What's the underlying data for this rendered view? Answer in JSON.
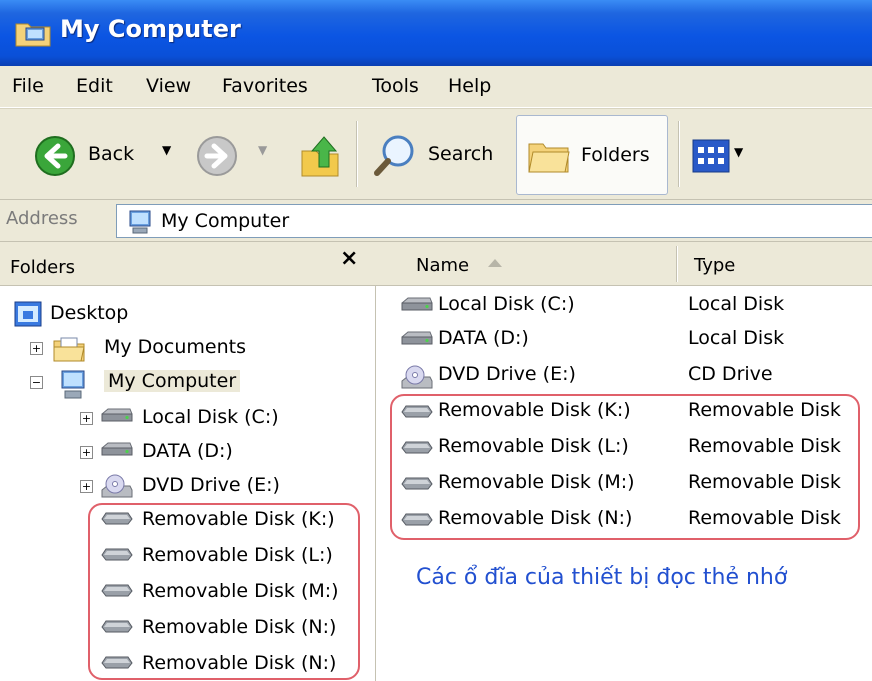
{
  "window": {
    "title": "My Computer",
    "title_icon": "folder-computer-icon"
  },
  "menu": [
    "File",
    "Edit",
    "View",
    "Favorites",
    "Tools",
    "Help"
  ],
  "toolbar": {
    "back_label": "Back",
    "search_label": "Search",
    "folders_label": "Folders"
  },
  "address": {
    "label": "Address",
    "value": "My Computer"
  },
  "folders_pane": {
    "title": "Folders",
    "close_glyph": "×",
    "tree": [
      {
        "label": "Desktop",
        "icon": "desktop-icon",
        "expander": ""
      },
      {
        "label": "My Documents",
        "icon": "my-documents-icon",
        "expander": "+"
      },
      {
        "label": "My Computer",
        "icon": "my-computer-icon",
        "expander": "−"
      },
      {
        "label": "Local Disk (C:)",
        "icon": "hard-disk-icon",
        "expander": "+"
      },
      {
        "label": "DATA (D:)",
        "icon": "hard-disk-icon",
        "expander": "+"
      },
      {
        "label": "DVD Drive (E:)",
        "icon": "dvd-drive-icon",
        "expander": "+"
      },
      {
        "label": "Removable Disk (K:)",
        "icon": "removable-disk-icon",
        "expander": ""
      },
      {
        "label": "Removable Disk (L:)",
        "icon": "removable-disk-icon",
        "expander": ""
      },
      {
        "label": "Removable Disk (M:)",
        "icon": "removable-disk-icon",
        "expander": ""
      },
      {
        "label": "Removable Disk (N:)",
        "icon": "removable-disk-icon",
        "expander": ""
      },
      {
        "label": "Removable Disk (N:)",
        "icon": "removable-disk-icon",
        "expander": ""
      }
    ]
  },
  "list": {
    "columns": {
      "name": "Name",
      "type": "Type"
    },
    "rows": [
      {
        "name": "Local Disk (C:)",
        "type": "Local Disk",
        "icon": "hard-disk-icon"
      },
      {
        "name": "DATA (D:)",
        "type": "Local Disk",
        "icon": "hard-disk-icon"
      },
      {
        "name": "DVD Drive (E:)",
        "type": "CD Drive",
        "icon": "dvd-drive-icon"
      },
      {
        "name": "Removable Disk (K:)",
        "type": "Removable Disk",
        "icon": "removable-disk-icon"
      },
      {
        "name": "Removable Disk (L:)",
        "type": "Removable Disk",
        "icon": "removable-disk-icon"
      },
      {
        "name": "Removable Disk (M:)",
        "type": "Removable Disk",
        "icon": "removable-disk-icon"
      },
      {
        "name": "Removable Disk (N:)",
        "type": "Removable Disk",
        "icon": "removable-disk-icon"
      }
    ]
  },
  "caption": "Các ổ đĩa của thiết bị đọc thẻ nhớ",
  "colors": {
    "title_blue": "#0b55e3",
    "chrome": "#ece9d8",
    "highlight_red": "#e0606a",
    "caption_blue": "#2250d0"
  }
}
